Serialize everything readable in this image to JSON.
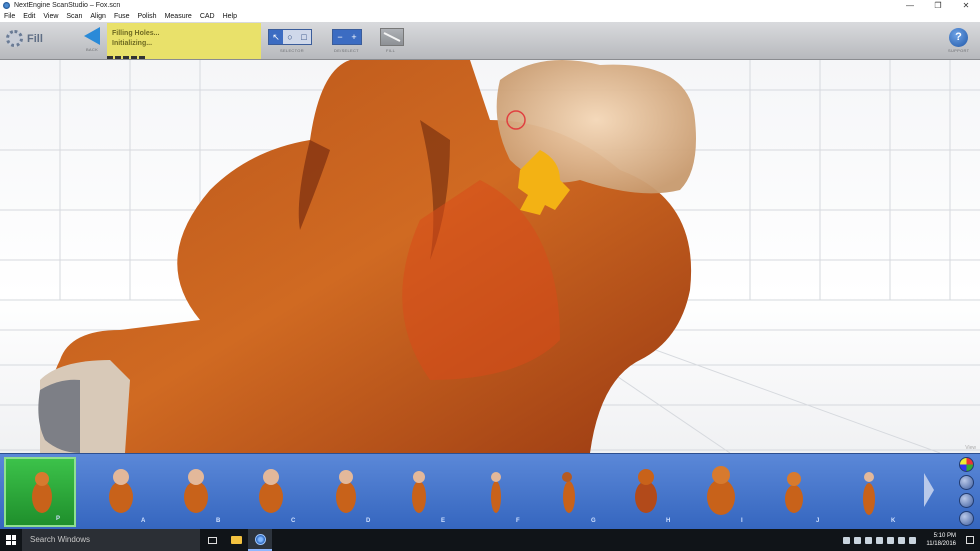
{
  "window": {
    "title": "NextEngine ScanStudio – Fox.scn",
    "controls": [
      "—",
      "❐",
      "✕"
    ]
  },
  "menu": [
    "File",
    "Edit",
    "View",
    "Scan",
    "Align",
    "Fuse",
    "Polish",
    "Measure",
    "CAD",
    "Help"
  ],
  "toolbar": {
    "mode_label": "Fill",
    "back_label": "BACK",
    "status_line1": "Filling Holes...",
    "status_line2": "Initializing...",
    "selector_label": "SELECTOR",
    "deselect_label": "DE/SELECT",
    "fill_label": "FILL",
    "help_glyph": "?",
    "help_label": "SUPPORT",
    "selector_tools": [
      "↖",
      "○",
      "□"
    ],
    "deselect_tools": [
      "−",
      "+"
    ]
  },
  "viewport": {
    "corner_label": "View",
    "model": "fox-scan",
    "accent_colors": {
      "fur": "#c8621a",
      "fill": "#f3b214",
      "grid": "#d6d9de"
    }
  },
  "thumbnails": [
    {
      "label": "P",
      "active": true
    },
    {
      "label": "A",
      "active": false
    },
    {
      "label": "B",
      "active": false
    },
    {
      "label": "C",
      "active": false
    },
    {
      "label": "D",
      "active": false
    },
    {
      "label": "E",
      "active": false
    },
    {
      "label": "F",
      "active": false
    },
    {
      "label": "G",
      "active": false
    },
    {
      "label": "H",
      "active": false
    },
    {
      "label": "I",
      "active": false
    },
    {
      "label": "J",
      "active": false
    },
    {
      "label": "K",
      "active": false
    }
  ],
  "taskbar": {
    "search_placeholder": "Search Windows",
    "time": "5:10 PM",
    "date": "11/18/2016"
  }
}
